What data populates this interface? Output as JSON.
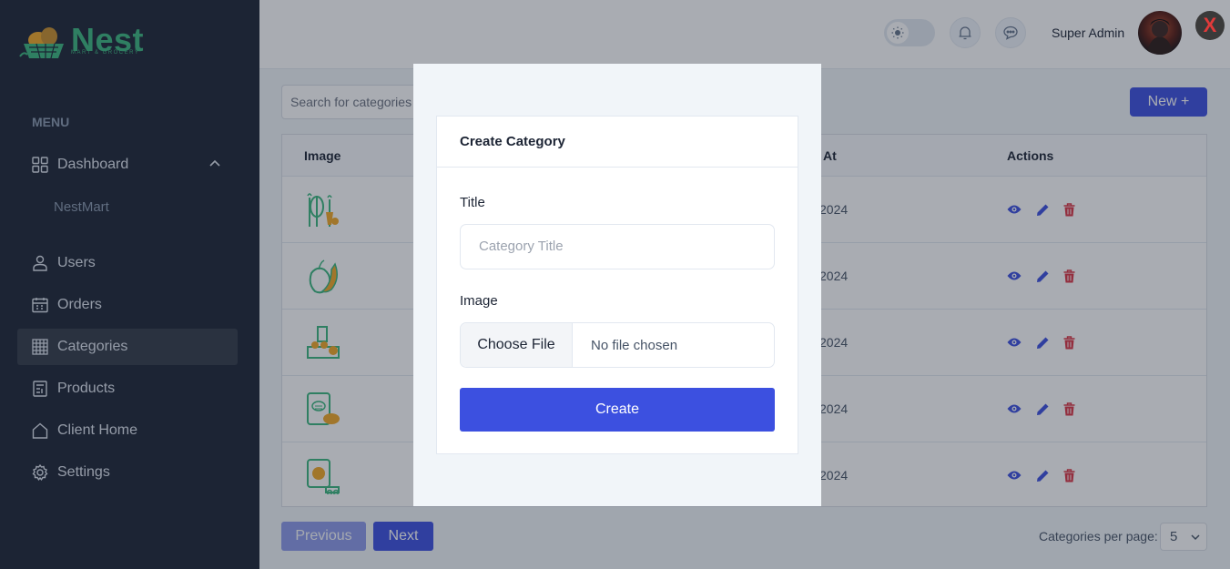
{
  "brand": {
    "name": "Nest",
    "tagline": "MART & GROCERY",
    "accent": "#3bb77e"
  },
  "sidebar": {
    "menu_label": "MENU",
    "items": [
      {
        "label": "Dashboard",
        "icon": "grid-icon"
      },
      {
        "label": "Users",
        "icon": "user-icon"
      },
      {
        "label": "Orders",
        "icon": "calendar-icon"
      },
      {
        "label": "Categories",
        "icon": "table-icon"
      },
      {
        "label": "Products",
        "icon": "document-icon"
      },
      {
        "label": "Client Home",
        "icon": "home-icon"
      },
      {
        "label": "Settings",
        "icon": "gear-icon"
      }
    ],
    "dashboard_sub": "NestMart",
    "active": "Categories"
  },
  "header": {
    "user_name": "Super Admin"
  },
  "main": {
    "search_placeholder": "Search for categories",
    "new_button": "New +",
    "columns": {
      "image": "Image",
      "created": "At",
      "actions": "Actions"
    },
    "rows": [
      {
        "date": "2024"
      },
      {
        "date": "2024"
      },
      {
        "date": "2024"
      },
      {
        "date": "2024"
      },
      {
        "date": "2024"
      }
    ],
    "prev_button": "Previous",
    "next_button": "Next",
    "per_page_label": "Categories per page:",
    "per_page_value": "5"
  },
  "modal": {
    "close_label": "X",
    "heading": "Create Category",
    "title_label": "Title",
    "title_placeholder": "Category Title",
    "image_label": "Image",
    "file_button": "Choose File",
    "file_status": "No file chosen",
    "submit": "Create"
  },
  "colors": {
    "primary": "#3c50e0",
    "sidebar": "#1c2434",
    "danger": "#dc3545"
  }
}
